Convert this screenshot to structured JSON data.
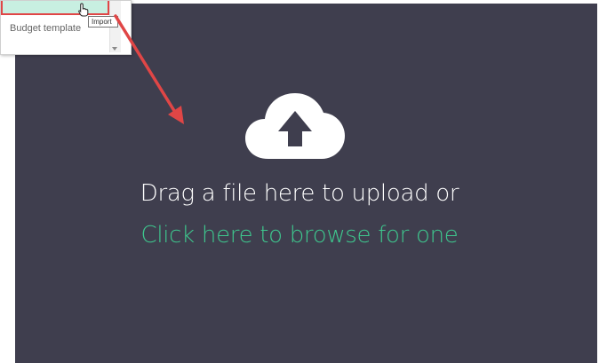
{
  "upload": {
    "title": "Drag a file here to upload or",
    "browse_link": "Click here to browse for one",
    "icon": "cloud-upload-icon"
  },
  "popup_menu": {
    "item_partial": "Import",
    "item_budget_template": "Budget template",
    "tooltip": "Import"
  },
  "colors": {
    "dropzone_bg": "#3f3e4e",
    "link_green": "#3ec78e",
    "highlight_red": "#e04646",
    "menu_highlight": "#c8efe1"
  },
  "annotation": {
    "arrow": "red-pointer-arrow-icon"
  }
}
